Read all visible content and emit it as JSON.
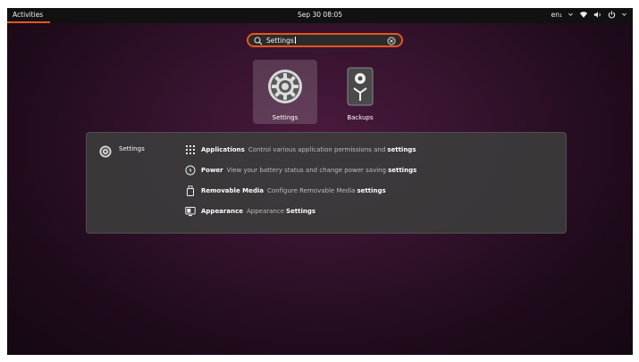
{
  "topbar": {
    "activities": "Activities",
    "clock": "Sep 30  08:05",
    "language": "en₁",
    "icons": [
      "chevron-down-icon",
      "wifi-icon",
      "volume-icon",
      "power-icon",
      "chevron-down-icon"
    ]
  },
  "search": {
    "query": "Settings",
    "icons": [
      "search-icon",
      "clear-icon"
    ]
  },
  "apps": [
    {
      "label": "Settings",
      "icon": "settings-gear-icon",
      "selected": true
    },
    {
      "label": "Backups",
      "icon": "backups-icon",
      "selected": false
    }
  ],
  "results": {
    "provider": {
      "name": "Settings",
      "icon": "settings-gear-icon"
    },
    "items": [
      {
        "title": "Applications",
        "desc": "Control various application permissions and",
        "highlight": "settings",
        "icon": "grid-icon"
      },
      {
        "title": "Power",
        "desc": "View your battery status and change power saving",
        "highlight": "settings",
        "icon": "power-circle-icon"
      },
      {
        "title": "Removable Media",
        "desc": "Configure Removable Media",
        "highlight": "settings",
        "icon": "removable-media-icon"
      },
      {
        "title": "Appearance",
        "desc": "Appearance",
        "highlight": "Settings",
        "icon": "appearance-icon"
      }
    ]
  },
  "colors": {
    "accent": "#e95420",
    "panel": "#3c3c3c",
    "topbar": "#111111"
  }
}
